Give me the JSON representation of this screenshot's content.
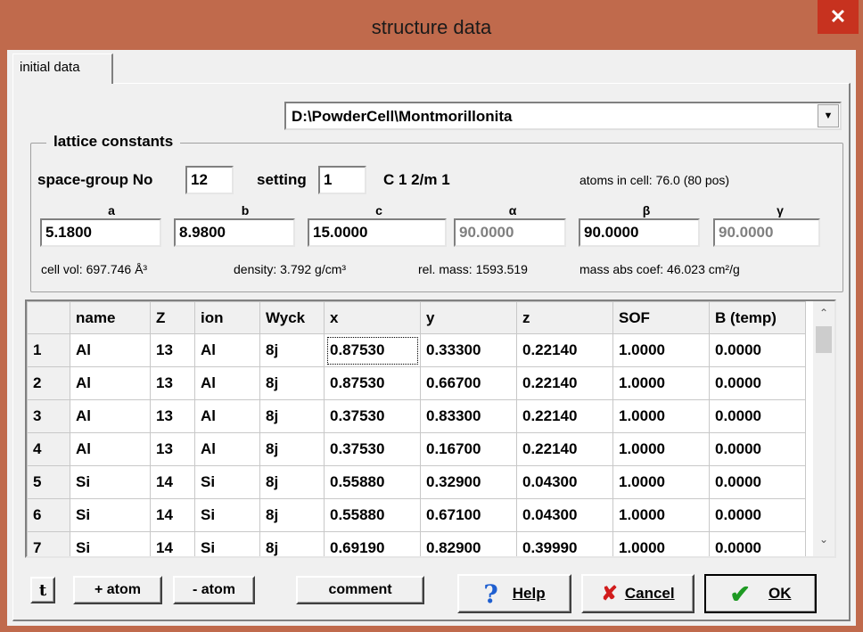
{
  "window": {
    "title": "structure data",
    "close_glyph": "✕"
  },
  "tab": {
    "label": "initial data"
  },
  "file": {
    "path": "D:\\PowderCell\\Montmorillonita",
    "arrow_glyph": "▼"
  },
  "lattice": {
    "group_title": "lattice constants",
    "space_group_label": "space-group No",
    "space_group_value": "12",
    "setting_label": "setting",
    "setting_value": "1",
    "symbol": "C 1 2/m 1",
    "atoms_in_cell": "atoms in cell: 76.0  (80 pos)",
    "headers": {
      "a": "a",
      "b": "b",
      "c": "c",
      "alpha": "α",
      "beta": "β",
      "gamma": "γ"
    },
    "values": {
      "a": "5.1800",
      "b": "8.9800",
      "c": "15.0000",
      "alpha": "90.0000",
      "beta": "90.0000",
      "gamma": "90.0000"
    },
    "cell_vol": "cell vol: 697.746 Å³",
    "density": "density: 3.792 g/cm³",
    "rel_mass": "rel. mass: 1593.519",
    "mass_abs": "mass abs coef: 46.023 cm²/g"
  },
  "grid": {
    "columns": [
      "",
      "name",
      "Z",
      "ion",
      "Wyck",
      "x",
      "y",
      "z",
      "SOF",
      "B (temp)"
    ],
    "rows": [
      [
        "1",
        "Al",
        "13",
        "Al",
        "8j",
        "0.87530",
        "0.33300",
        "0.22140",
        "1.0000",
        "0.0000"
      ],
      [
        "2",
        "Al",
        "13",
        "Al",
        "8j",
        "0.87530",
        "0.66700",
        "0.22140",
        "1.0000",
        "0.0000"
      ],
      [
        "3",
        "Al",
        "13",
        "Al",
        "8j",
        "0.37530",
        "0.83300",
        "0.22140",
        "1.0000",
        "0.0000"
      ],
      [
        "4",
        "Al",
        "13",
        "Al",
        "8j",
        "0.37530",
        "0.16700",
        "0.22140",
        "1.0000",
        "0.0000"
      ],
      [
        "5",
        "Si",
        "14",
        "Si",
        "8j",
        "0.55880",
        "0.32900",
        "0.04300",
        "1.0000",
        "0.0000"
      ],
      [
        "6",
        "Si",
        "14",
        "Si",
        "8j",
        "0.55880",
        "0.67100",
        "0.04300",
        "1.0000",
        "0.0000"
      ],
      [
        "7",
        "Si",
        "14",
        "Si",
        "8j",
        "0.69190",
        "0.82900",
        "0.39990",
        "1.0000",
        "0.0000"
      ]
    ],
    "scroll_up": "⌃",
    "scroll_down": "⌄"
  },
  "buttons": {
    "t_label": "t",
    "add_atom": "+ atom",
    "remove_atom": "- atom",
    "comment": "comment",
    "help_label": "Help",
    "help_icon": "?",
    "cancel_label": "Cancel",
    "cancel_icon": "✘",
    "ok_label": "OK",
    "ok_icon": "✔"
  }
}
